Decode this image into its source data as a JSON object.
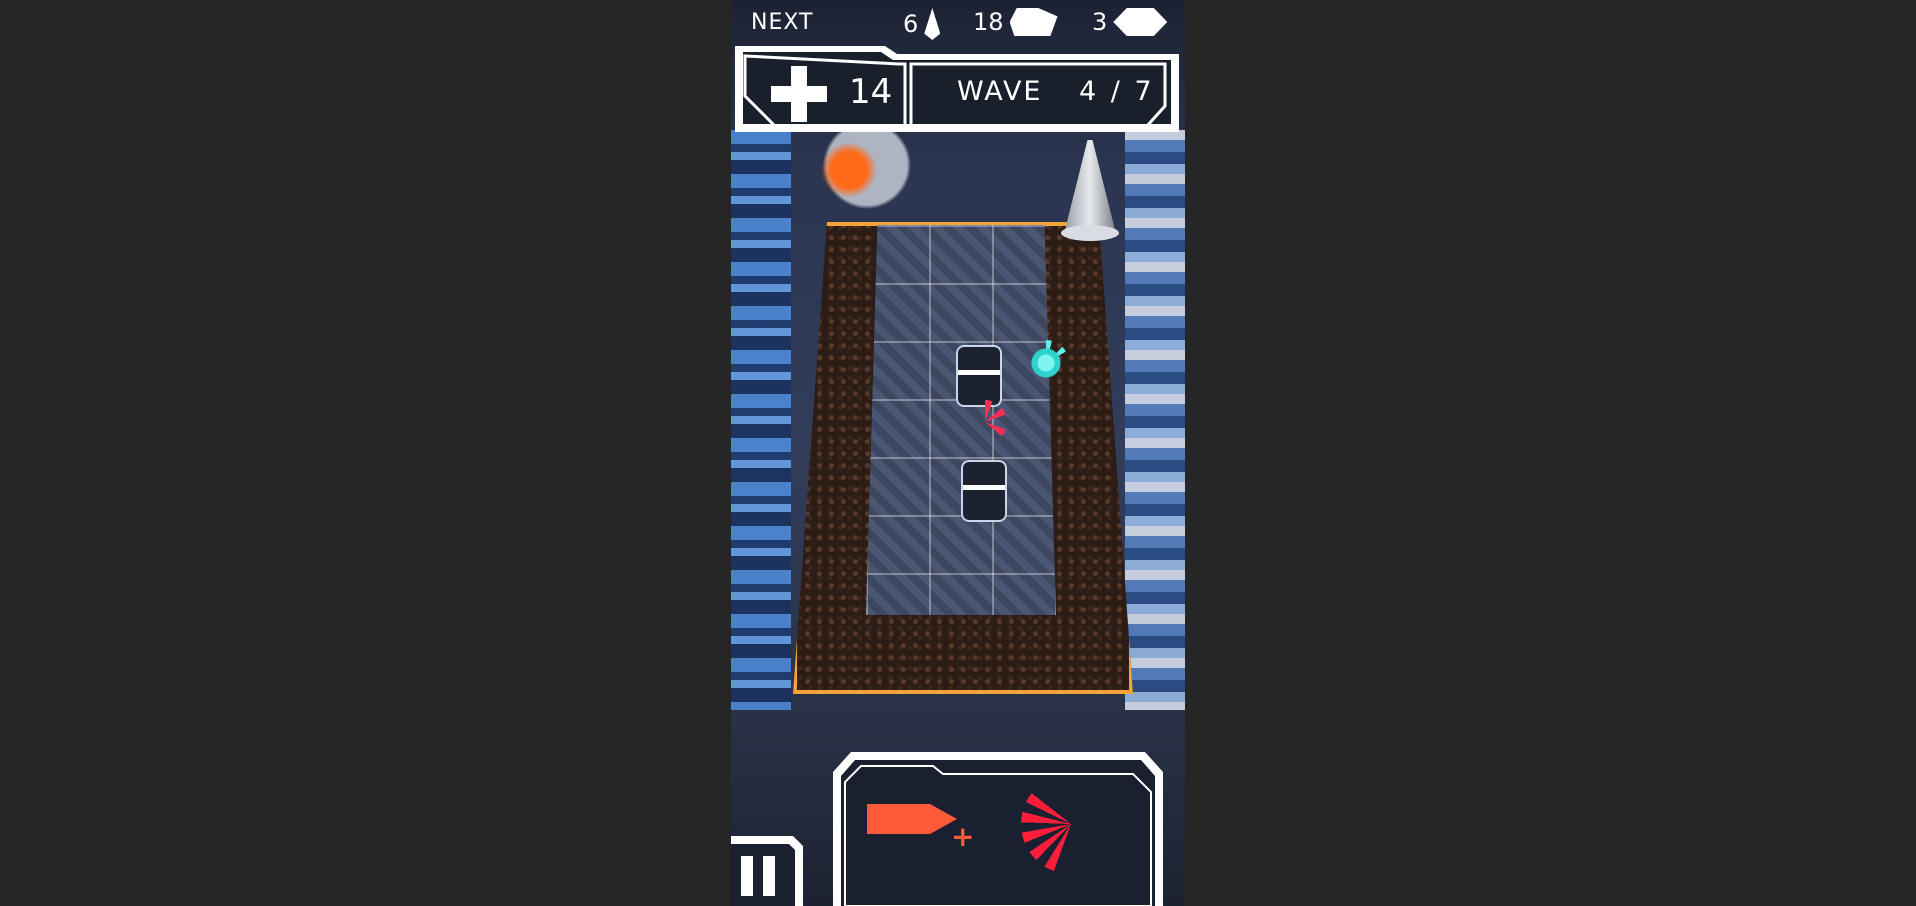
{
  "hud": {
    "next_label": "NEXT",
    "resources": [
      {
        "value": "6",
        "icon": "spike-icon"
      },
      {
        "value": "18",
        "icon": "cubes-icon"
      },
      {
        "value": "3",
        "icon": "hex-chip-icon"
      }
    ],
    "health": "14",
    "wave_label": "WAVE",
    "wave_value": "4 / 7"
  },
  "abilities": [
    {
      "name": "ammo-plus",
      "icon": "bullet-plus-icon",
      "color": "#ff5a3a"
    },
    {
      "name": "burst",
      "icon": "burst-icon",
      "color": "#ff1e3a"
    }
  ],
  "colors": {
    "background": "#262626",
    "accent_orange": "#ff9a2e",
    "ability_red": "#ff1e3a",
    "ui_white": "#ffffff"
  }
}
